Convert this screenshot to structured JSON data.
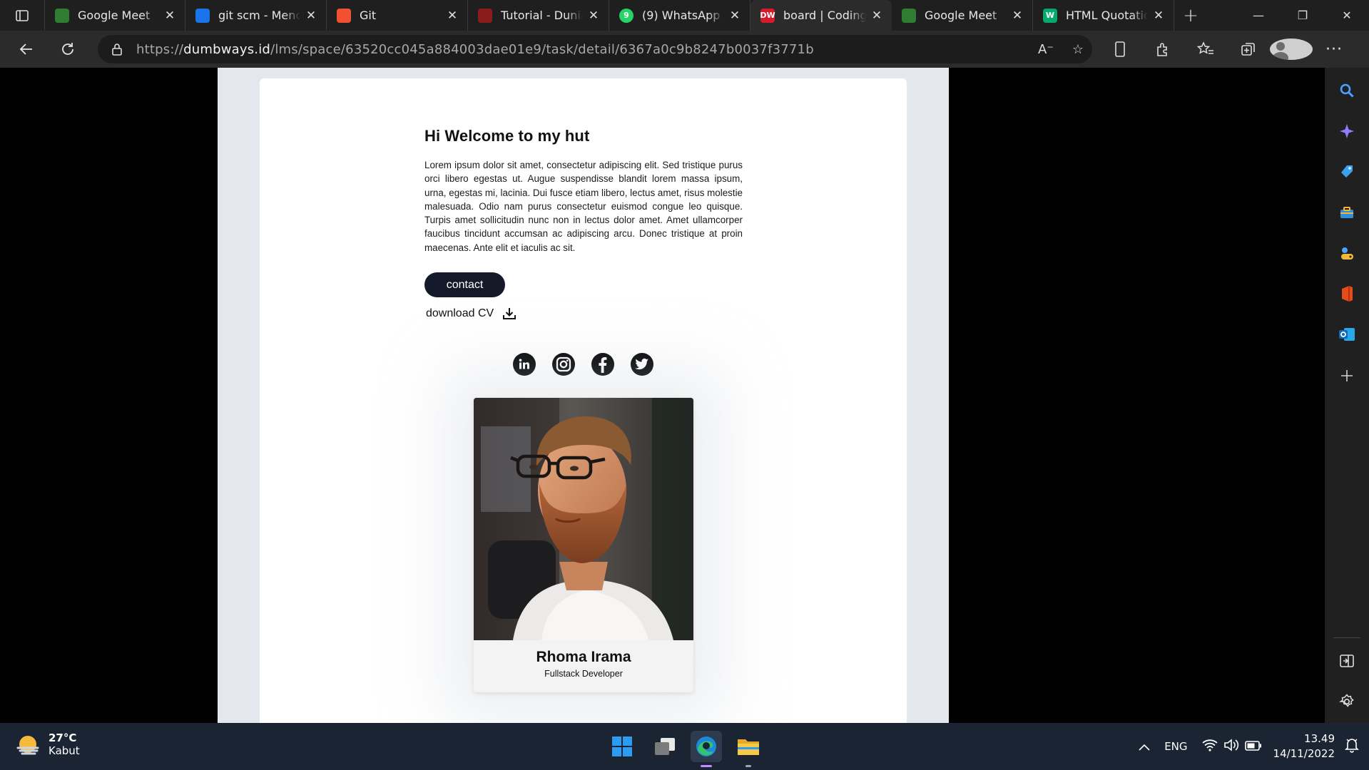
{
  "browser": {
    "tabs": [
      {
        "title": "Google Meet",
        "fav_color": "#2e7d32",
        "icon": "google-meet-icon"
      },
      {
        "title": "git scm - Mencari",
        "fav_color": "#1a73e8",
        "icon": "search-icon"
      },
      {
        "title": "Git",
        "fav_color": "#f05133",
        "icon": "git-icon"
      },
      {
        "title": "Tutorial - Dunia Coding",
        "fav_color": "#8b1c1c",
        "icon": "youtube-icon"
      },
      {
        "title": "(9) WhatsApp",
        "fav_color": "#25d366",
        "icon": "whatsapp-icon",
        "badge": "9"
      },
      {
        "title": "board | Coding",
        "fav_color": "#d81b2b",
        "icon": "dumbways-icon",
        "fav_text": "DW"
      },
      {
        "title": "Google Meet",
        "fav_color": "#2e7d32",
        "icon": "google-meet-icon"
      },
      {
        "title": "HTML Quotation",
        "fav_color": "#04aa6d",
        "icon": "w3schools-icon",
        "fav_text": "W"
      }
    ],
    "active_tab": 5,
    "url_prefix": "https://",
    "url_domain": "dumbways.id",
    "url_path": "/lms/space/63520cc045a884003dae01e9/task/detail/6367a0c9b8247b0037f3771b"
  },
  "page": {
    "heading": "Hi Welcome to my hut",
    "paragraph": "Lorem ipsum dolor sit amet, consectetur adipiscing elit. Sed tristique purus orci libero egestas ut. Augue suspendisse blandit lorem massa ipsum, urna, egestas mi, lacinia. Dui fusce etiam libero, lectus amet, risus molestie malesuada. Odio nam purus consectetur euismod congue leo quisque. Turpis amet sollicitudin nunc non in lectus dolor amet. Amet ullamcorper faucibus tincidunt accumsan ac adipiscing arcu. Donec tristique at proin maecenas. Ante elit et iaculis ac sit.",
    "contact_label": "contact",
    "download_label": "download CV",
    "socials": [
      "linkedin-icon",
      "instagram-icon",
      "facebook-icon",
      "twitter-icon"
    ],
    "profile_name": "Rhoma Irama",
    "profile_role": "Fullstack Developer"
  },
  "taskbar": {
    "temperature": "27°C",
    "weather": "Kabut",
    "language": "ENG",
    "time": "13.49",
    "date": "14/11/2022"
  },
  "colors": {
    "accent_button": "#151a2b",
    "page_bg": "#e4e7ed",
    "taskbar_bg": "#1b2433"
  }
}
